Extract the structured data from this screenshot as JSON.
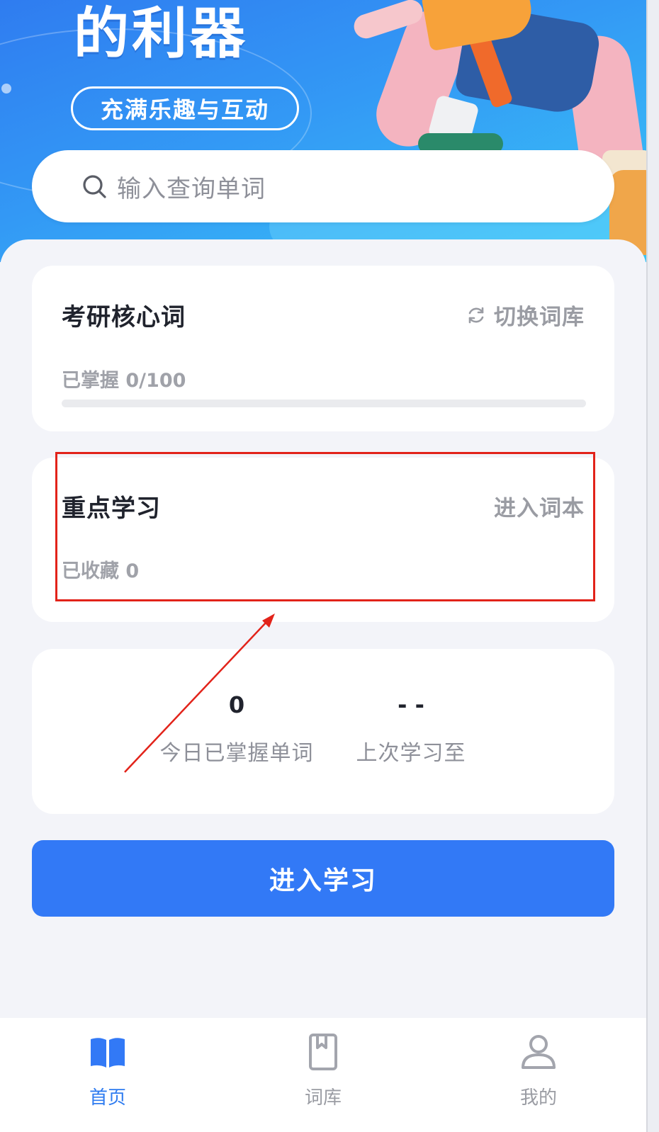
{
  "banner": {
    "headline": "的利器",
    "badge": "充满乐趣与互动"
  },
  "search": {
    "placeholder": "输入查询单词"
  },
  "wordbook_card": {
    "title": "考研核心词",
    "switch_label": "切换词库",
    "mastered_text": "已掌握 0/100",
    "progress": 0.0
  },
  "focus_card": {
    "title": "重点学习",
    "link_label": "进入词本",
    "collected_text": "已收藏 0"
  },
  "stats_card": {
    "today": {
      "value": "0",
      "label": "今日已掌握单词"
    },
    "last": {
      "value": "- -",
      "label": "上次学习至"
    }
  },
  "cta": {
    "label": "进入学习"
  },
  "tabbar": {
    "items": [
      {
        "label": "首页",
        "icon": "book-open-icon",
        "active": true
      },
      {
        "label": "词库",
        "icon": "bookmark-book-icon",
        "active": false
      },
      {
        "label": "我的",
        "icon": "user-icon",
        "active": false
      }
    ]
  },
  "colors": {
    "accent": "#3279f6",
    "highlight": "#e2231a",
    "muted_text": "#9a9ca3"
  }
}
